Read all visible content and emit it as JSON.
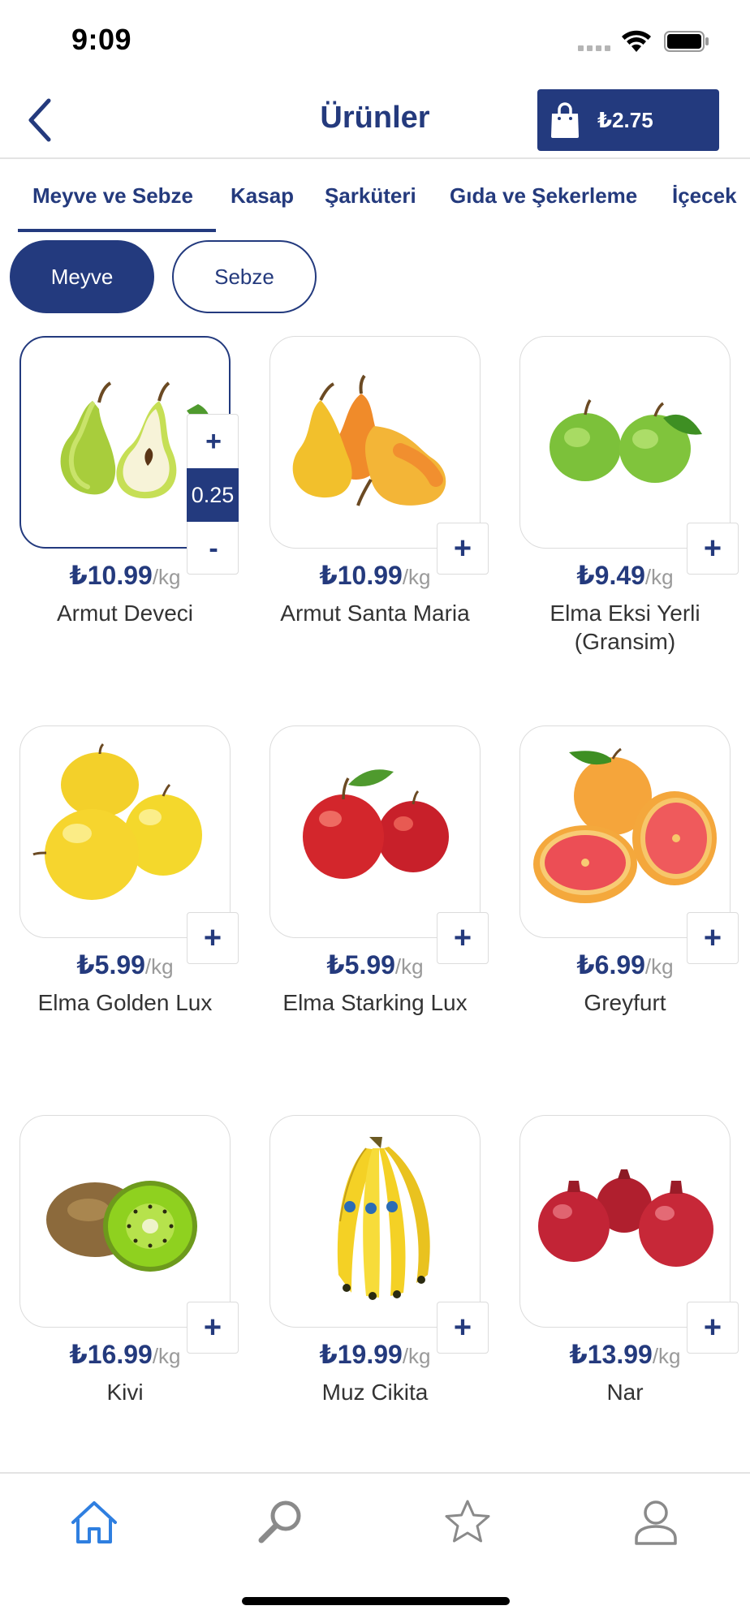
{
  "status_bar": {
    "time": "9:09"
  },
  "header": {
    "title": "Ürünler",
    "cart_total": "₺2.75"
  },
  "categories": [
    "Meyve ve Sebze",
    "Kasap",
    "Şarküteri",
    "Gıda ve Şekerleme",
    "İçecek"
  ],
  "subcategories": {
    "active": "Meyve",
    "other": "Sebze"
  },
  "unit": "/kg",
  "products": [
    {
      "price": "₺10.99",
      "name": "Armut Deveci",
      "quantity": "0.25"
    },
    {
      "price": "₺10.99",
      "name": "Armut Santa Maria"
    },
    {
      "price": "₺9.49",
      "name": "Elma  Eksi Yerli (Gransim)"
    },
    {
      "price": "₺5.99",
      "name": "Elma Golden Lux"
    },
    {
      "price": "₺5.99",
      "name": "Elma Starking Lux"
    },
    {
      "price": "₺6.99",
      "name": "Greyfurt"
    },
    {
      "price": "₺16.99",
      "name": "Kivi"
    },
    {
      "price": "₺19.99",
      "name": "Muz Cikita"
    },
    {
      "price": "₺13.99",
      "name": "Nar"
    }
  ],
  "stepper": {
    "plus": "+",
    "minus": "-"
  },
  "add_label": "+",
  "colors": {
    "brand": "#233a7e",
    "active_tab": "#2f7fe0",
    "muted": "#9a9a9a"
  },
  "tab_bar": [
    "home-icon",
    "search-icon",
    "star-icon",
    "profile-icon"
  ]
}
